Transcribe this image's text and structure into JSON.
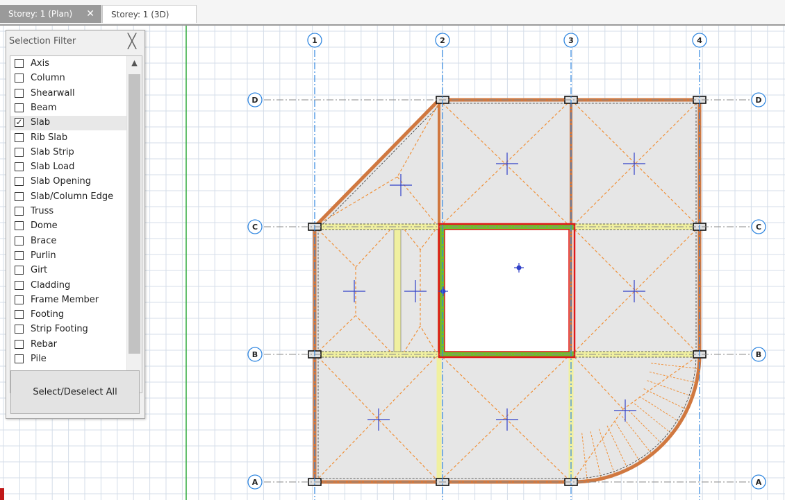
{
  "tabs": {
    "active": "Storey: 1 (Plan)",
    "close_glyph": "✕",
    "inactive": "Storey: 1 (3D)"
  },
  "filter": {
    "title": "Selection Filter",
    "close_glyph": "╳",
    "items": [
      {
        "label": "Axis",
        "checked": false
      },
      {
        "label": "Column",
        "checked": false
      },
      {
        "label": "Shearwall",
        "checked": false
      },
      {
        "label": "Beam",
        "checked": false
      },
      {
        "label": "Slab",
        "checked": true
      },
      {
        "label": "Rib Slab",
        "checked": false
      },
      {
        "label": "Slab Strip",
        "checked": false
      },
      {
        "label": "Slab Load",
        "checked": false
      },
      {
        "label": "Slab Opening",
        "checked": false
      },
      {
        "label": "Slab/Column Edge",
        "checked": false
      },
      {
        "label": "Truss",
        "checked": false
      },
      {
        "label": "Dome",
        "checked": false
      },
      {
        "label": "Brace",
        "checked": false
      },
      {
        "label": "Purlin",
        "checked": false
      },
      {
        "label": "Girt",
        "checked": false
      },
      {
        "label": "Cladding",
        "checked": false
      },
      {
        "label": "Frame Member",
        "checked": false
      },
      {
        "label": "Footing",
        "checked": false
      },
      {
        "label": "Strip Footing",
        "checked": false
      },
      {
        "label": "Rebar",
        "checked": false
      },
      {
        "label": "Pile",
        "checked": false
      }
    ],
    "scroll_up": "▲",
    "scroll_down": "▼",
    "select_all": "Select/Deselect All"
  },
  "plan": {
    "axes_x": [
      "1",
      "2",
      "3",
      "4"
    ],
    "axes_y": [
      "D",
      "C",
      "B",
      "A"
    ]
  },
  "colors": {
    "grid": "#d4dde8",
    "axis": "#2f86e0",
    "slab_fill": "#e6e6e6",
    "beam": "#d07840",
    "yield_line": "#f0913a",
    "selected_beam": "#6fbe2e",
    "selection_outline": "#e01818",
    "wall_strip": "#f0f0a0",
    "marker": "#3040c8",
    "guide": "#2eaa3c"
  }
}
